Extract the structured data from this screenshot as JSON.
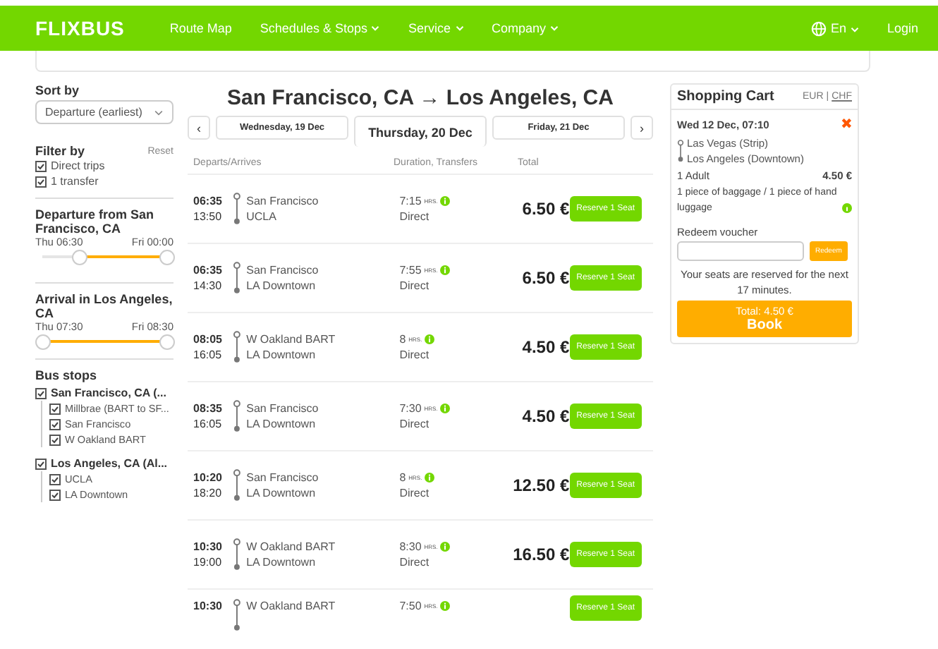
{
  "header": {
    "logo": "FLIXBUS",
    "nav": [
      {
        "label": "Route Map",
        "dropdown": false
      },
      {
        "label": "Schedules & Stops",
        "dropdown": true
      },
      {
        "label": "Service",
        "dropdown": true
      },
      {
        "label": "Company",
        "dropdown": true
      }
    ],
    "language": "En",
    "login": "Login"
  },
  "sidebar": {
    "sort_label": "Sort by",
    "sort_value": "Departure (earliest)",
    "filter_label": "Filter by",
    "reset": "Reset",
    "filters": [
      {
        "label": "Direct trips",
        "checked": true
      },
      {
        "label": "1 transfer",
        "checked": true
      }
    ],
    "sliders": [
      {
        "title": "Departure from San Francisco, CA",
        "min_label": "Thu 06:30",
        "max_label": "Fri 00:00",
        "thumbs": [
          {
            "level": 0.3
          },
          {
            "level": 1
          }
        ]
      },
      {
        "title": "Arrival in Los Angeles, CA",
        "min_label": "Thu 07:30",
        "max_label": "Fri 08:30",
        "thumbs": [
          {
            "level": 0
          },
          {
            "level": 1
          }
        ]
      }
    ],
    "stops_title": "Bus stops",
    "stops": [
      {
        "label": "San Francisco, CA (...",
        "checked": true,
        "children": [
          {
            "label": "Millbrae (BART to SF...",
            "checked": true
          },
          {
            "label": "San Francisco",
            "checked": true
          },
          {
            "label": "W Oakland BART",
            "checked": true
          }
        ]
      },
      {
        "label": "Los Angeles, CA (Al...",
        "checked": true,
        "children": [
          {
            "label": "UCLA",
            "checked": true
          },
          {
            "label": "LA Downtown",
            "checked": true
          }
        ]
      }
    ]
  },
  "route_title": "San Francisco, CA → Los Angeles, CA",
  "prev": "‹",
  "next": "›",
  "days": [
    {
      "label": "Wednesday, 19 Dec",
      "selected": false
    },
    {
      "label": "Thursday, 20 Dec",
      "selected": true
    },
    {
      "label": "Friday, 21 Dec",
      "selected": false
    }
  ],
  "columns": [
    "Departs/Arrives",
    "Duration, Transfers",
    "Total"
  ],
  "journeys": [
    {
      "depart": "06:35",
      "arrive": "13:50",
      "from": "San Francisco",
      "to": "UCLA",
      "duration": "7:15",
      "hrs": "HRS.",
      "transfers": "Direct",
      "price": "6.50 €",
      "button": "Reserve 1 Seat"
    },
    {
      "depart": "06:35",
      "arrive": "14:30",
      "from": "San Francisco",
      "to": "LA Downtown",
      "duration": "7:55",
      "hrs": "HRS.",
      "transfers": "Direct",
      "price": "6.50 €",
      "button": "Reserve 1 Seat"
    },
    {
      "depart": "08:05",
      "arrive": "16:05",
      "from": "W Oakland BART",
      "to": "LA Downtown",
      "duration": "8",
      "hrs": "HRS.",
      "transfers": "Direct",
      "price": "4.50 €",
      "button": "Reserve 1 Seat"
    },
    {
      "depart": "08:35",
      "arrive": "16:05",
      "from": "San Francisco",
      "to": "LA Downtown",
      "duration": "7:30",
      "hrs": "HRS.",
      "transfers": "Direct",
      "price": "4.50 €",
      "button": "Reserve 1 Seat"
    },
    {
      "depart": "10:20",
      "arrive": "18:20",
      "from": "San Francisco",
      "to": "LA Downtown",
      "duration": "8",
      "hrs": "HRS.",
      "transfers": "Direct",
      "price": "12.50 €",
      "button": "Reserve 1 Seat"
    },
    {
      "depart": "10:30",
      "arrive": "19:00",
      "from": "W Oakland BART",
      "to": "LA Downtown",
      "duration": "8:30",
      "hrs": "HRS.",
      "transfers": "Direct",
      "price": "16.50 €",
      "button": "Reserve 1 Seat"
    },
    {
      "depart": "10:30",
      "from": "W Oakland BART",
      "duration": "7:50",
      "hrs": "HRS.",
      "button": "Reserve 1 Seat"
    }
  ],
  "cart": {
    "title": "Shopping Cart",
    "currencies": [
      {
        "label": "EUR",
        "selected": true
      },
      {
        "label": "CHF",
        "selected": false
      }
    ],
    "separator": "|",
    "trip_date": "Wed 12 Dec, 07:10",
    "remove": "✖",
    "from": "Las Vegas (Strip)",
    "to": "Los Angeles (Downtown)",
    "passengers": "1 Adult",
    "price": "4.50 €",
    "baggage": "1 piece of baggage / 1 piece of hand luggage",
    "voucher_label": "Redeem voucher",
    "redeem": "Redeem",
    "notice": "Your seats are reserved for the next 17 minutes.",
    "total": "Total: 4.50 €",
    "book": "Book"
  }
}
